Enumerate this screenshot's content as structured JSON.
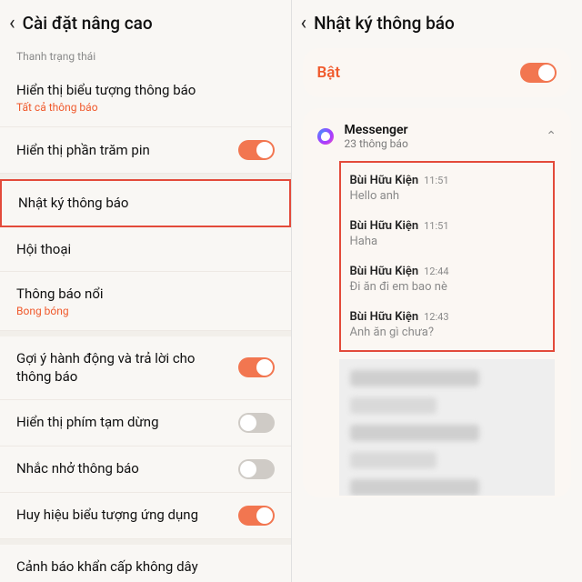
{
  "left": {
    "title": "Cài đặt nâng cao",
    "section_label": "Thanh trạng thái",
    "rows": [
      {
        "primary": "Hiển thị biểu tượng thông báo",
        "secondary": "Tất cả thông báo",
        "toggle": null
      },
      {
        "primary": "Hiển thị phần trăm pin",
        "secondary": null,
        "toggle": "on"
      },
      {
        "primary": "Nhật ký thông báo",
        "secondary": null,
        "toggle": null,
        "highlight": true
      },
      {
        "primary": "Hội thoại",
        "secondary": null,
        "toggle": null
      },
      {
        "primary": "Thông báo nổi",
        "secondary": "Bong bóng",
        "toggle": null
      },
      {
        "primary": "Gợi ý hành động và trả lời cho thông báo",
        "secondary": null,
        "toggle": "on"
      },
      {
        "primary": "Hiển thị phím tạm dừng",
        "secondary": null,
        "toggle": "off"
      },
      {
        "primary": "Nhắc nhở thông báo",
        "secondary": null,
        "toggle": "off"
      },
      {
        "primary": "Huy hiệu biểu tượng ứng dụng",
        "secondary": null,
        "toggle": "on"
      },
      {
        "primary": "Cảnh báo khẩn cấp không dây",
        "secondary": null,
        "toggle": null
      }
    ]
  },
  "right": {
    "title": "Nhật ký thông báo",
    "master_label": "Bật",
    "master_toggle": "on",
    "app": {
      "name": "Messenger",
      "count": "23 thông báo"
    },
    "notifs": [
      {
        "sender": "Bùi Hữu Kiện",
        "time": "11:51",
        "body": "Hello anh"
      },
      {
        "sender": "Bùi Hữu Kiện",
        "time": "11:51",
        "body": "Haha"
      },
      {
        "sender": "Bùi Hữu Kiện",
        "time": "12:44",
        "body": "Đi ăn đi em bao nè"
      },
      {
        "sender": "Bùi Hữu Kiện",
        "time": "12:43",
        "body": "Anh ăn gì chưa?"
      }
    ]
  }
}
